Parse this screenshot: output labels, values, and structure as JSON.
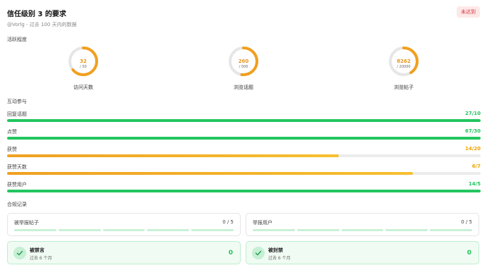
{
  "header": {
    "title": "信任级别 3 的要求",
    "subtitle": "@Vorlg - 过去 100 天内的数据",
    "status_badge": "未达到",
    "badge_color": "#d9363e"
  },
  "activity": {
    "section_label": "活跃程度",
    "rings": [
      {
        "value": "32",
        "max": "/ 50",
        "label": "访问天数",
        "fraction": 0.64
      },
      {
        "value": "260",
        "max": "/ 500",
        "label": "浏览话题",
        "fraction": 0.52
      },
      {
        "value": "8262",
        "max": "/ 20000",
        "label": "浏览帖子",
        "fraction": 0.41
      }
    ],
    "ring_color": "#f0a020"
  },
  "interaction": {
    "section_label": "互动参与",
    "bars": [
      {
        "label": "回复话题",
        "value": "27/10",
        "fraction": 1.0,
        "status": "green"
      },
      {
        "label": "点赞",
        "value": "67/30",
        "fraction": 1.0,
        "status": "green"
      },
      {
        "label": "获赞",
        "value": "14/20",
        "fraction": 0.7,
        "status": "orange"
      },
      {
        "label": "获赞天数",
        "value": "6/7",
        "fraction": 0.857,
        "status": "orange"
      },
      {
        "label": "获赞用户",
        "value": "14/5",
        "fraction": 1.0,
        "status": "green"
      }
    ]
  },
  "compliance": {
    "section_label": "合规记录",
    "cards": [
      {
        "title": "被举报帖子",
        "value": "0 / 5"
      },
      {
        "title": "举报用户",
        "value": "0 / 5"
      }
    ],
    "ok_cards": [
      {
        "title": "被禁言",
        "subtitle": "过去 6 个月",
        "count": "0"
      },
      {
        "title": "被封禁",
        "subtitle": "过去 6 个月",
        "count": "0"
      }
    ]
  }
}
